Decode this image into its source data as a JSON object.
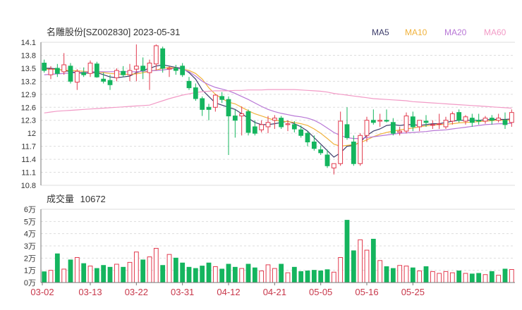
{
  "header": {
    "title": "名雕股份[SZ002830] 2023-05-31",
    "legend": [
      {
        "name": "MA5",
        "color": "#3d3d6b"
      },
      {
        "name": "MA10",
        "color": "#f0b23c"
      },
      {
        "name": "MA20",
        "color": "#b877d6"
      },
      {
        "name": "MA60",
        "color": "#f29ac6"
      }
    ]
  },
  "volume_header": {
    "label": "成交量",
    "value": "10672"
  },
  "colors": {
    "up": "#e23a4e",
    "down": "#14b55e",
    "grid": "#dddddd",
    "axis": "#777777"
  },
  "chart_data": [
    {
      "type": "candlestick",
      "title": "名雕股份[SZ002830] 2023-05-31",
      "ylim": [
        10.8,
        14.1
      ],
      "y_ticks": [
        "14.1",
        "13.8",
        "13.5",
        "13.2",
        "12.9",
        "12.6",
        "12.3",
        "12",
        "11.7",
        "11.4",
        "11.1",
        "10.8"
      ],
      "x_ticks": [
        "03-02",
        "03-13",
        "03-22",
        "03-31",
        "04-12",
        "04-21",
        "05-05",
        "05-16",
        "05-25"
      ],
      "x_tick_index": [
        0,
        7,
        14,
        21,
        28,
        35,
        42,
        49,
        56
      ],
      "ohlc": [
        [
          13.62,
          13.7,
          13.4,
          13.45
        ],
        [
          13.35,
          13.55,
          13.25,
          13.48
        ],
        [
          13.5,
          13.6,
          13.3,
          13.38
        ],
        [
          13.42,
          13.85,
          13.35,
          13.58
        ],
        [
          13.55,
          13.62,
          13.15,
          13.2
        ],
        [
          13.18,
          13.48,
          13.0,
          13.43
        ],
        [
          13.4,
          13.52,
          13.3,
          13.35
        ],
        [
          13.38,
          13.68,
          13.3,
          13.62
        ],
        [
          13.6,
          13.65,
          13.28,
          13.3
        ],
        [
          13.25,
          13.4,
          13.15,
          13.2
        ],
        [
          13.22,
          13.35,
          13.0,
          13.12
        ],
        [
          13.28,
          13.5,
          13.2,
          13.45
        ],
        [
          13.43,
          13.55,
          13.3,
          13.35
        ],
        [
          13.35,
          13.6,
          13.2,
          13.45
        ],
        [
          13.48,
          14.05,
          13.2,
          13.55
        ],
        [
          13.55,
          13.75,
          13.25,
          13.45
        ],
        [
          13.4,
          13.7,
          13.0,
          13.62
        ],
        [
          13.6,
          14.05,
          13.45,
          14.02
        ],
        [
          13.95,
          14.0,
          13.4,
          13.5
        ],
        [
          13.48,
          13.55,
          13.3,
          13.5
        ],
        [
          13.5,
          13.58,
          13.35,
          13.45
        ],
        [
          13.55,
          13.62,
          13.3,
          13.35
        ],
        [
          13.2,
          13.3,
          13.0,
          13.05
        ],
        [
          13.05,
          13.15,
          12.75,
          12.8
        ],
        [
          12.8,
          12.85,
          12.4,
          12.55
        ],
        [
          12.6,
          12.68,
          12.3,
          12.55
        ],
        [
          12.6,
          12.9,
          12.5,
          12.88
        ],
        [
          12.85,
          12.95,
          12.7,
          12.78
        ],
        [
          12.78,
          12.85,
          11.5,
          12.4
        ],
        [
          12.4,
          12.55,
          11.9,
          12.3
        ],
        [
          12.4,
          12.62,
          11.95,
          12.45
        ],
        [
          12.5,
          12.55,
          11.95,
          12.02
        ],
        [
          12.15,
          12.3,
          11.95,
          12.0
        ],
        [
          12.08,
          12.3,
          12.02,
          12.2
        ],
        [
          12.15,
          12.4,
          12.0,
          12.25
        ],
        [
          12.3,
          12.42,
          12.1,
          12.35
        ],
        [
          12.35,
          12.4,
          12.1,
          12.15
        ],
        [
          12.2,
          12.3,
          12.05,
          12.22
        ],
        [
          12.2,
          12.28,
          12.02,
          12.1
        ],
        [
          12.08,
          12.18,
          11.9,
          11.95
        ],
        [
          12.0,
          12.05,
          11.7,
          11.8
        ],
        [
          11.8,
          11.95,
          11.6,
          11.65
        ],
        [
          11.62,
          11.72,
          11.5,
          11.55
        ],
        [
          11.5,
          11.62,
          11.2,
          11.25
        ],
        [
          11.2,
          11.3,
          11.05,
          11.3
        ],
        [
          11.3,
          12.5,
          11.25,
          12.28
        ],
        [
          12.2,
          12.6,
          11.85,
          11.9
        ],
        [
          11.8,
          11.95,
          11.25,
          11.3
        ],
        [
          11.3,
          12.0,
          11.25,
          11.95
        ],
        [
          11.95,
          12.38,
          11.8,
          12.3
        ],
        [
          12.3,
          12.55,
          12.2,
          12.25
        ],
        [
          12.28,
          12.45,
          12.15,
          12.3
        ],
        [
          12.3,
          12.55,
          12.25,
          12.28
        ],
        [
          12.25,
          12.35,
          11.95,
          12.0
        ],
        [
          12.02,
          12.15,
          11.95,
          12.05
        ],
        [
          12.05,
          12.48,
          12.0,
          12.4
        ],
        [
          12.38,
          12.5,
          12.05,
          12.15
        ],
        [
          12.15,
          12.3,
          12.05,
          12.3
        ],
        [
          12.28,
          12.42,
          12.15,
          12.25
        ],
        [
          12.2,
          12.3,
          12.1,
          12.2
        ],
        [
          12.22,
          12.45,
          12.1,
          12.22
        ],
        [
          12.15,
          12.38,
          12.1,
          12.3
        ],
        [
          12.28,
          12.5,
          12.2,
          12.45
        ],
        [
          12.48,
          12.55,
          12.25,
          12.3
        ],
        [
          12.28,
          12.42,
          12.2,
          12.38
        ],
        [
          12.35,
          12.45,
          12.15,
          12.25
        ],
        [
          12.3,
          12.45,
          12.2,
          12.28
        ],
        [
          12.28,
          12.4,
          12.22,
          12.35
        ],
        [
          12.35,
          12.42,
          12.2,
          12.3
        ],
        [
          12.3,
          12.45,
          12.25,
          12.35
        ],
        [
          12.3,
          12.48,
          12.1,
          12.2
        ],
        [
          12.25,
          12.55,
          12.15,
          12.48
        ]
      ],
      "ma": {
        "MA5": [
          13.5,
          13.5,
          13.48,
          13.45,
          13.42,
          13.4,
          13.38,
          13.4,
          13.4,
          13.35,
          13.3,
          13.28,
          13.3,
          13.32,
          13.4,
          13.45,
          13.5,
          13.55,
          13.58,
          13.55,
          13.52,
          13.5,
          13.4,
          13.25,
          13.0,
          12.85,
          12.7,
          12.65,
          12.6,
          12.55,
          12.45,
          12.35,
          12.25,
          12.2,
          12.2,
          12.22,
          12.25,
          12.28,
          12.22,
          12.15,
          12.05,
          11.9,
          11.75,
          11.6,
          11.45,
          11.55,
          11.7,
          11.72,
          11.8,
          11.95,
          12.05,
          12.1,
          12.18,
          12.2,
          12.18,
          12.2,
          12.2,
          12.18,
          12.2,
          12.22,
          12.22,
          12.25,
          12.28,
          12.3,
          12.3,
          12.3,
          12.3,
          12.31,
          12.32,
          12.32,
          12.32,
          12.33
        ],
        "MA10": [
          13.48,
          13.48,
          13.47,
          13.46,
          13.45,
          13.44,
          13.43,
          13.42,
          13.41,
          13.4,
          13.38,
          13.37,
          13.36,
          13.36,
          13.37,
          13.4,
          13.43,
          13.46,
          13.5,
          13.52,
          13.5,
          13.48,
          13.45,
          13.38,
          13.25,
          13.05,
          12.9,
          12.8,
          12.72,
          12.68,
          12.6,
          12.52,
          12.45,
          12.4,
          12.35,
          12.3,
          12.28,
          12.27,
          12.25,
          12.22,
          12.18,
          12.1,
          12.0,
          11.88,
          11.75,
          11.7,
          11.72,
          11.74,
          11.78,
          11.85,
          11.92,
          11.98,
          12.02,
          12.05,
          12.08,
          12.1,
          12.12,
          12.15,
          12.17,
          12.19,
          12.2,
          12.21,
          12.22,
          12.24,
          12.25,
          12.26,
          12.27,
          12.28,
          12.29,
          12.3,
          12.3,
          12.31
        ],
        "MA20": [
          13.35,
          13.36,
          13.37,
          13.38,
          13.39,
          13.4,
          13.41,
          13.42,
          13.42,
          13.42,
          13.42,
          13.42,
          13.42,
          13.42,
          13.42,
          13.43,
          13.44,
          13.45,
          13.46,
          13.48,
          13.5,
          13.48,
          13.42,
          13.32,
          13.2,
          13.12,
          13.06,
          13.02,
          12.98,
          12.92,
          12.85,
          12.78,
          12.7,
          12.62,
          12.55,
          12.5,
          12.46,
          12.43,
          12.4,
          12.38,
          12.35,
          12.3,
          12.22,
          12.12,
          12.02,
          11.95,
          11.9,
          11.88,
          11.88,
          11.9,
          11.92,
          11.94,
          11.96,
          11.98,
          12.0,
          12.01,
          12.02,
          12.03,
          12.04,
          12.06,
          12.07,
          12.08,
          12.1,
          12.12,
          12.14,
          12.16,
          12.18,
          12.2,
          12.21,
          12.22,
          12.22,
          12.23
        ],
        "MA60": [
          12.47,
          12.49,
          12.51,
          12.52,
          12.53,
          12.54,
          12.55,
          12.56,
          12.57,
          12.58,
          12.59,
          12.6,
          12.61,
          12.62,
          12.63,
          12.64,
          12.65,
          12.7,
          12.75,
          12.8,
          12.84,
          12.88,
          12.91,
          12.94,
          12.96,
          12.97,
          12.98,
          12.98,
          12.98,
          12.99,
          12.99,
          13.0,
          13.0,
          13.0,
          13.01,
          13.01,
          13.01,
          13.01,
          13.01,
          13.0,
          12.99,
          12.98,
          12.97,
          12.95,
          12.92,
          12.9,
          12.88,
          12.86,
          12.84,
          12.82,
          12.8,
          12.79,
          12.78,
          12.77,
          12.76,
          12.75,
          12.73,
          12.72,
          12.71,
          12.7,
          12.69,
          12.68,
          12.67,
          12.66,
          12.65,
          12.64,
          12.63,
          12.62,
          12.61,
          12.6,
          12.59,
          12.58
        ]
      }
    },
    {
      "type": "bar",
      "title": "成交量 10672",
      "ylim": [
        0,
        60000
      ],
      "y_ticks": [
        "6万",
        "5万",
        "4万",
        "3万",
        "2万",
        "1万",
        "0万"
      ],
      "values": [
        8800,
        10000,
        23500,
        11000,
        18500,
        20500,
        15500,
        13500,
        11500,
        14000,
        12500,
        15000,
        12500,
        16500,
        25000,
        18500,
        21000,
        28000,
        14000,
        23000,
        20000,
        16000,
        12500,
        11500,
        13500,
        16000,
        13000,
        11000,
        15000,
        12500,
        11500,
        15000,
        12000,
        9500,
        14500,
        11500,
        15000,
        8000,
        12500,
        9000,
        9500,
        10000,
        9500,
        10500,
        8500,
        20500,
        51000,
        26000,
        35000,
        26500,
        35500,
        18000,
        13000,
        11500,
        14000,
        13500,
        12000,
        9500,
        13000,
        9000,
        7500,
        9000,
        8000,
        9500,
        7500,
        7000,
        7500,
        6500,
        9000,
        6000,
        11000,
        10672
      ]
    }
  ]
}
